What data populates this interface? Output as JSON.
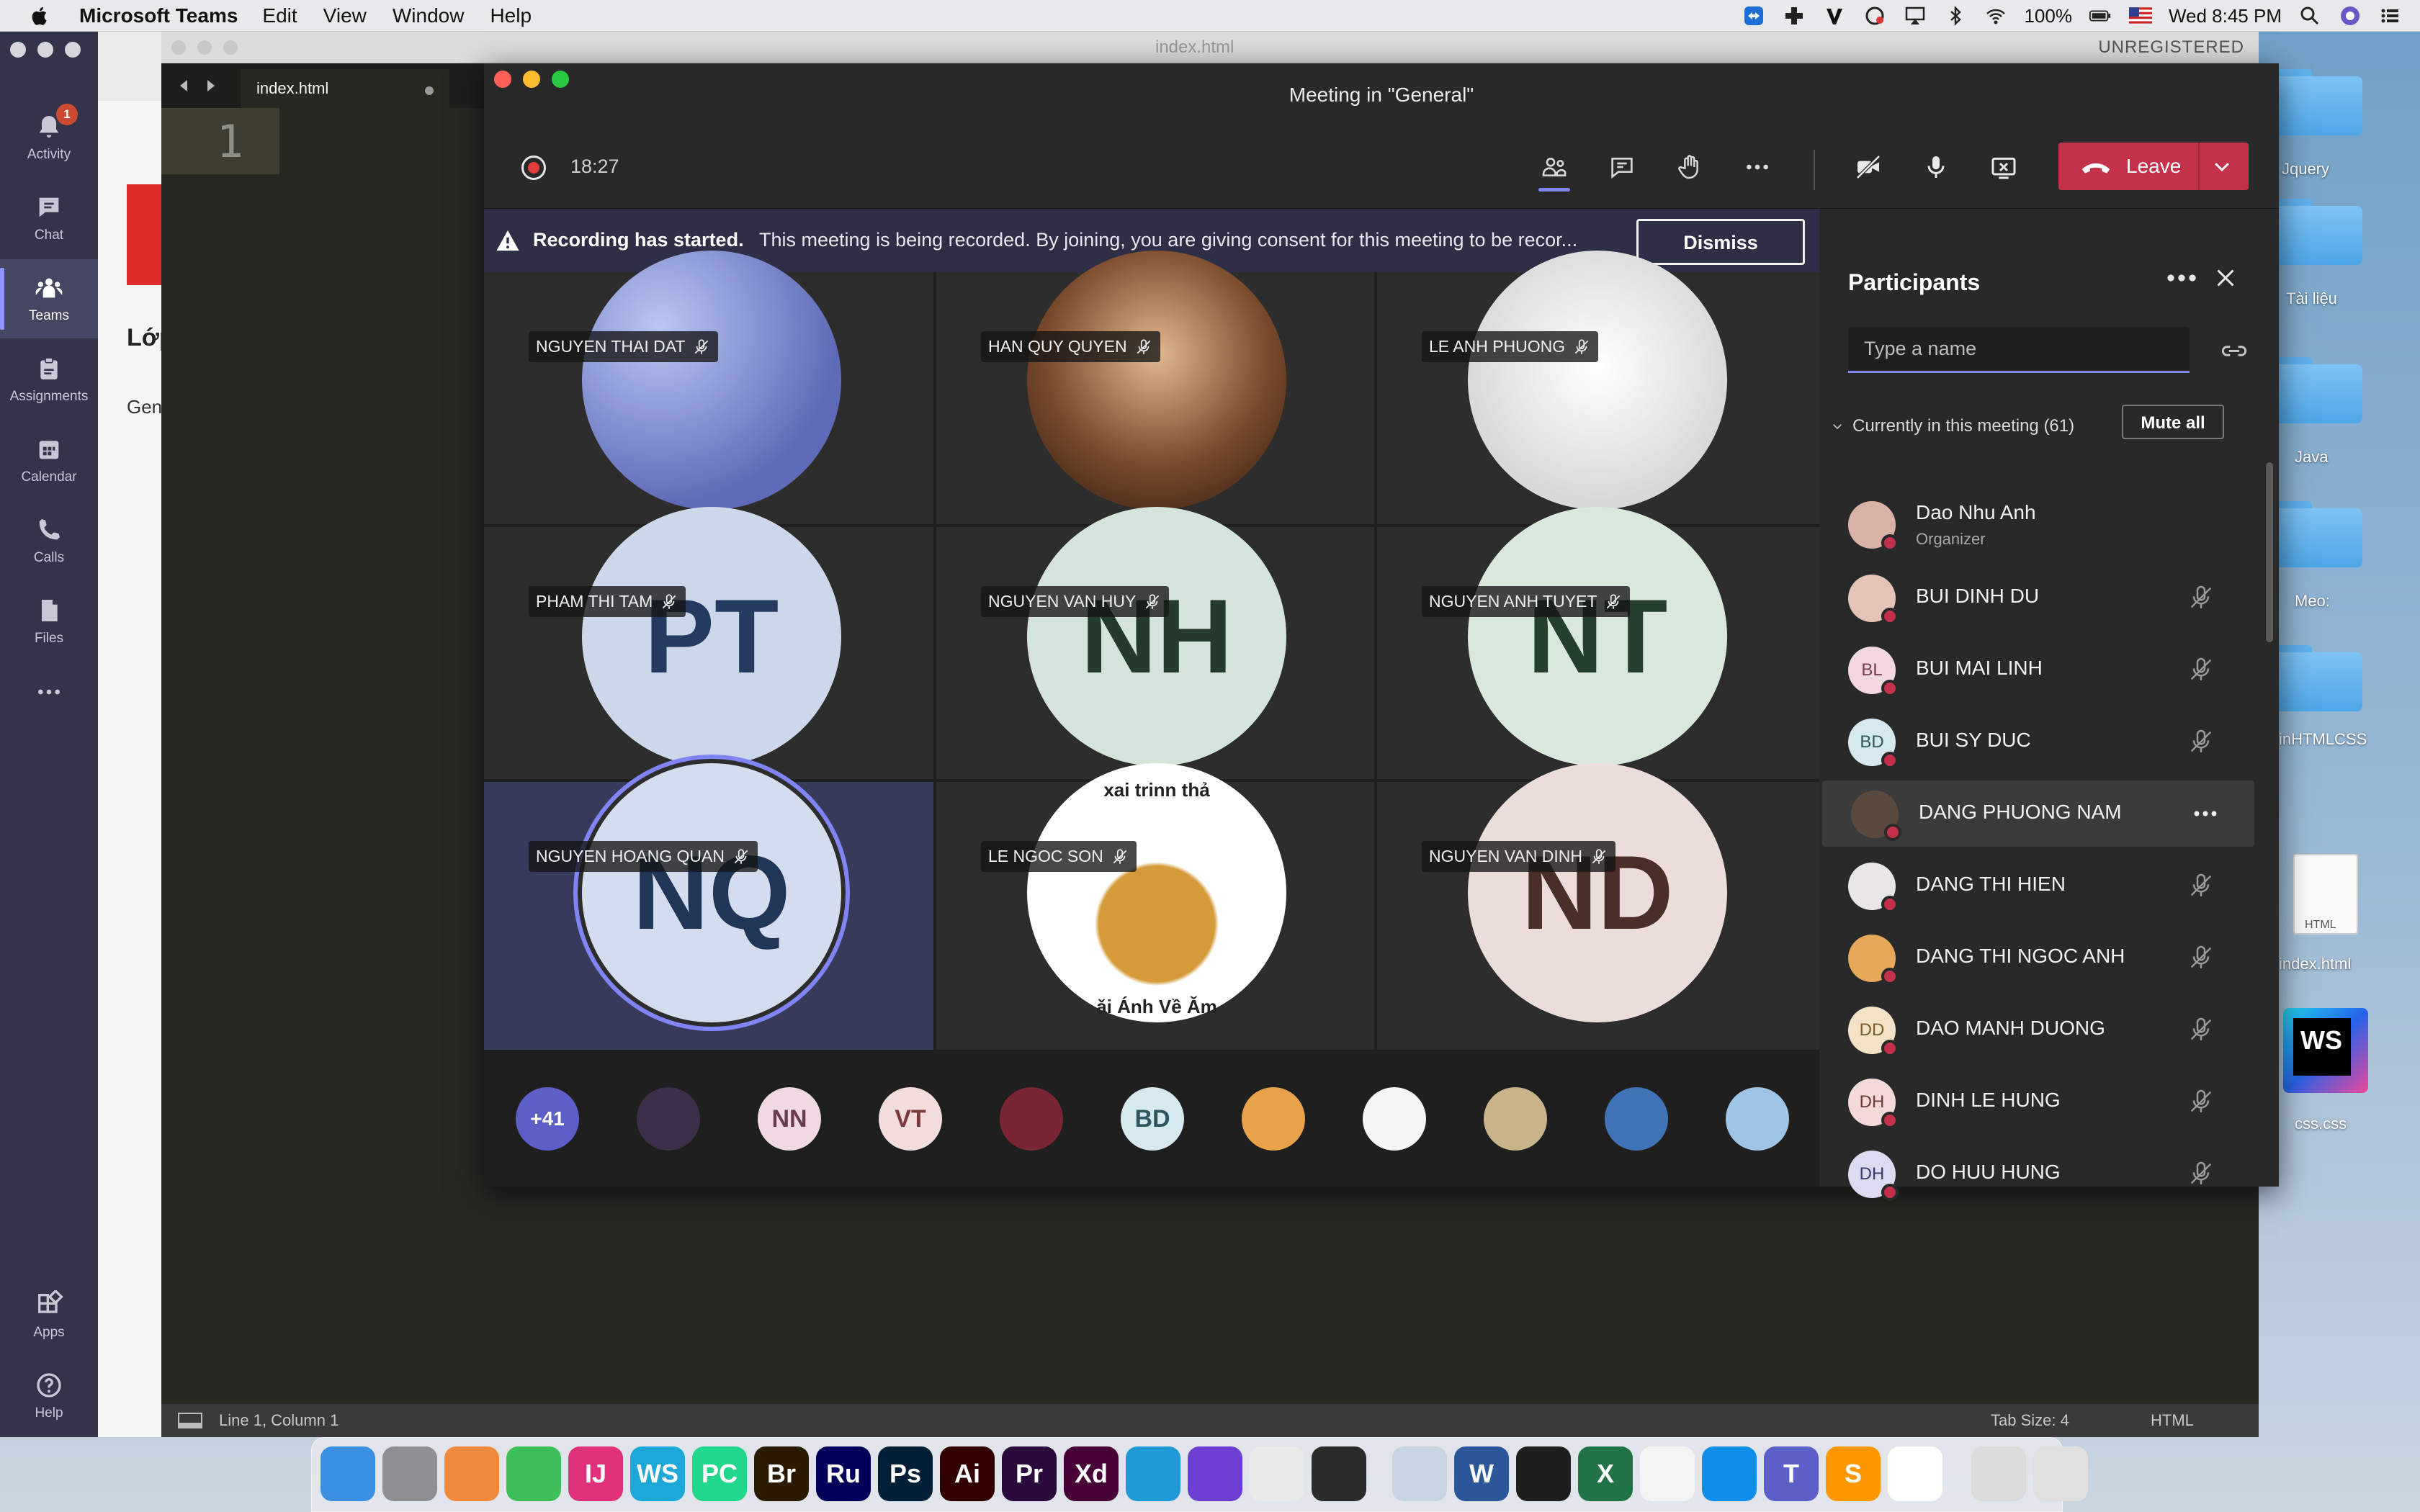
{
  "menubar": {
    "app": "Microsoft Teams",
    "items": [
      "Edit",
      "View",
      "Window",
      "Help"
    ],
    "battery": "100%",
    "clock": "Wed 8:45 PM"
  },
  "teams_rail": {
    "items": [
      {
        "label": "Activity",
        "icon": "bell-icon",
        "badge": "1"
      },
      {
        "label": "Chat",
        "icon": "chat-icon"
      },
      {
        "label": "Teams",
        "icon": "teams-icon"
      },
      {
        "label": "Assignments",
        "icon": "assignments-icon"
      },
      {
        "label": "Calendar",
        "icon": "calendar-icon"
      },
      {
        "label": "Calls",
        "icon": "phone-icon"
      },
      {
        "label": "Files",
        "icon": "files-icon"
      }
    ],
    "bottom": [
      {
        "label": "Apps",
        "icon": "apps-icon"
      },
      {
        "label": "Help",
        "icon": "help-icon"
      }
    ],
    "active": "Teams"
  },
  "teams_content": {
    "class_heading": "Lớp",
    "channel": "Gen"
  },
  "sublime": {
    "title": "index.html",
    "unregistered": "UNREGISTERED",
    "tab": "index.html",
    "line_number": "1",
    "status_pos": "Line 1, Column 1",
    "tab_size": "Tab Size: 4",
    "syntax": "HTML"
  },
  "meeting": {
    "title": "Meeting in \"General\"",
    "timer": "18:27",
    "leave_label": "Leave",
    "banner_bold": "Recording has started.",
    "banner_msg": "This meeting is being recorded. By joining, you are giving consent for this meeting to be recor...",
    "dismiss": "Dismiss",
    "tiles": [
      {
        "name": "NGUYEN THAI DAT",
        "initials": "",
        "kind": "image",
        "bg": "#7d86c8"
      },
      {
        "name": "HAN QUY QUYEN",
        "initials": "",
        "kind": "image",
        "bg": "#8a5a3a"
      },
      {
        "name": "LE ANH PHUONG",
        "initials": "",
        "kind": "image",
        "bg": "#e9e9e9"
      },
      {
        "name": "PHAM THI TAM",
        "initials": "PT",
        "kind": "initials",
        "bg": "#cbd8ea",
        "fg": "#243a5e"
      },
      {
        "name": "NGUYEN VAN HUY",
        "initials": "NH",
        "kind": "initials",
        "bg": "#d3e4da",
        "fg": "#233b2c"
      },
      {
        "name": "NGUYEN ANH TUYET",
        "initials": "NT",
        "kind": "initials",
        "bg": "#d8e8dd",
        "fg": "#253f2d"
      },
      {
        "name": "NGUYEN HOANG QUAN",
        "initials": "NQ",
        "kind": "initials",
        "bg": "#d4dded",
        "fg": "#1f3656",
        "speaking": true
      },
      {
        "name": "LE NGOC SON",
        "initials": "",
        "kind": "image",
        "bg": "#ffffff",
        "caption_top": "xai trinn thả",
        "caption_bottom": "ǎi Ánh Về Ǎm"
      },
      {
        "name": "NGUYEN VAN DINH",
        "initials": "ND",
        "kind": "initials",
        "bg": "#ecdcda",
        "fg": "#4a2f28"
      }
    ],
    "strip": [
      {
        "label": "+41",
        "bg": "#5b5fc7",
        "fg": "#ffffff"
      },
      {
        "label": "",
        "bg": "#3d2f4a"
      },
      {
        "label": "NN",
        "bg": "#f0d9e2",
        "fg": "#6a3a4e"
      },
      {
        "label": "VT",
        "bg": "#f3dcdc",
        "fg": "#7a3a3a"
      },
      {
        "label": "",
        "bg": "#7a2632"
      },
      {
        "label": "BD",
        "bg": "#d6e9ee",
        "fg": "#2f5560"
      },
      {
        "label": "",
        "bg": "#e8a24a"
      },
      {
        "label": "",
        "bg": "#f5f5f5"
      },
      {
        "label": "",
        "bg": "#c9b48a"
      },
      {
        "label": "",
        "bg": "#3f73b5"
      },
      {
        "label": "",
        "bg": "#9ec5e6"
      }
    ]
  },
  "participants": {
    "title": "Participants",
    "search_placeholder": "Type a name",
    "current_header": "Currently in this meeting (61)",
    "mute_all": "Mute all",
    "list": [
      {
        "name": "Dao Nhu Anh",
        "role": "Organizer",
        "initials": "",
        "bg": "#d9b2a6"
      },
      {
        "name": "BUI DINH DU",
        "initials": "",
        "bg": "#e3c4b7"
      },
      {
        "name": "BUI MAI LINH",
        "initials": "BL",
        "bg": "#f2d8de",
        "fg": "#7a3d4d"
      },
      {
        "name": "BUI SY DUC",
        "initials": "BD",
        "bg": "#d6e9ee",
        "fg": "#2f5560"
      },
      {
        "name": "DANG PHUONG NAM",
        "initials": "",
        "bg": "#5a4a3e",
        "hover": true
      },
      {
        "name": "DANG THI HIEN",
        "initials": "",
        "bg": "#e9e6e6"
      },
      {
        "name": "DANG THI NGOC ANH",
        "initials": "",
        "bg": "#e7a75a"
      },
      {
        "name": "DAO MANH DUONG",
        "initials": "DD",
        "bg": "#f3e3c6",
        "fg": "#7a5a2a"
      },
      {
        "name": "DINH LE HUNG",
        "initials": "DH",
        "bg": "#f3dad8",
        "fg": "#6d3a36"
      },
      {
        "name": "DO HUU HUNG",
        "initials": "DH",
        "bg": "#dcdcf0",
        "fg": "#3a3a6d"
      }
    ]
  },
  "desktop": {
    "labels": [
      "Jquery",
      "Tài liệu",
      "Java",
      "Meo:",
      "inHTMLCSS",
      "index.html",
      "css.css"
    ],
    "file_badge": "HTML",
    "ws_badge": "WS"
  },
  "dock": [
    {
      "name": "finder",
      "label": "",
      "bg": "#3b8fe0"
    },
    {
      "name": "system-preferences",
      "label": "",
      "bg": "#8e8e93"
    },
    {
      "name": "pages",
      "label": "",
      "bg": "#f08a3c"
    },
    {
      "name": "maps",
      "label": "",
      "bg": "#3fbf5a"
    },
    {
      "name": "intellij",
      "label": "IJ",
      "bg": "#e0327a"
    },
    {
      "name": "webstorm",
      "label": "WS",
      "bg": "#1ea8d8"
    },
    {
      "name": "pycharm",
      "label": "PC",
      "bg": "#21d789"
    },
    {
      "name": "bridge",
      "label": "Br",
      "bg": "#2a1a00"
    },
    {
      "name": "rush",
      "label": "Ru",
      "bg": "#00005b"
    },
    {
      "name": "photoshop",
      "label": "Ps",
      "bg": "#001e36"
    },
    {
      "name": "illustrator",
      "label": "Ai",
      "bg": "#330000"
    },
    {
      "name": "premiere",
      "label": "Pr",
      "bg": "#2a0a3a"
    },
    {
      "name": "xd",
      "label": "Xd",
      "bg": "#470137"
    },
    {
      "name": "edge",
      "label": "",
      "bg": "#1f9ad6"
    },
    {
      "name": "imovie-star",
      "label": "",
      "bg": "#6b3fd1"
    },
    {
      "name": "chrome",
      "label": "",
      "bg": "#e9e9e9"
    },
    {
      "name": "quicktime",
      "label": "",
      "bg": "#2b2b2b"
    },
    {
      "name": "preview",
      "label": "",
      "bg": "#c7d4e2"
    },
    {
      "name": "word",
      "label": "W",
      "bg": "#2b579a"
    },
    {
      "name": "terminal",
      "label": "",
      "bg": "#1e1e1e"
    },
    {
      "name": "excel",
      "label": "X",
      "bg": "#217346"
    },
    {
      "name": "slack-like",
      "label": "",
      "bg": "#f4f4f4"
    },
    {
      "name": "teamviewer",
      "label": "",
      "bg": "#0e8ee9"
    },
    {
      "name": "teams",
      "label": "T",
      "bg": "#5b5fc7"
    },
    {
      "name": "sublime",
      "label": "S",
      "bg": "#ff9800"
    },
    {
      "name": "affinity",
      "label": "",
      "bg": "#ffffff"
    },
    {
      "name": "downloads",
      "label": "",
      "bg": "#dcdcdc"
    },
    {
      "name": "trash",
      "label": "",
      "bg": "#e0e0e0"
    }
  ]
}
